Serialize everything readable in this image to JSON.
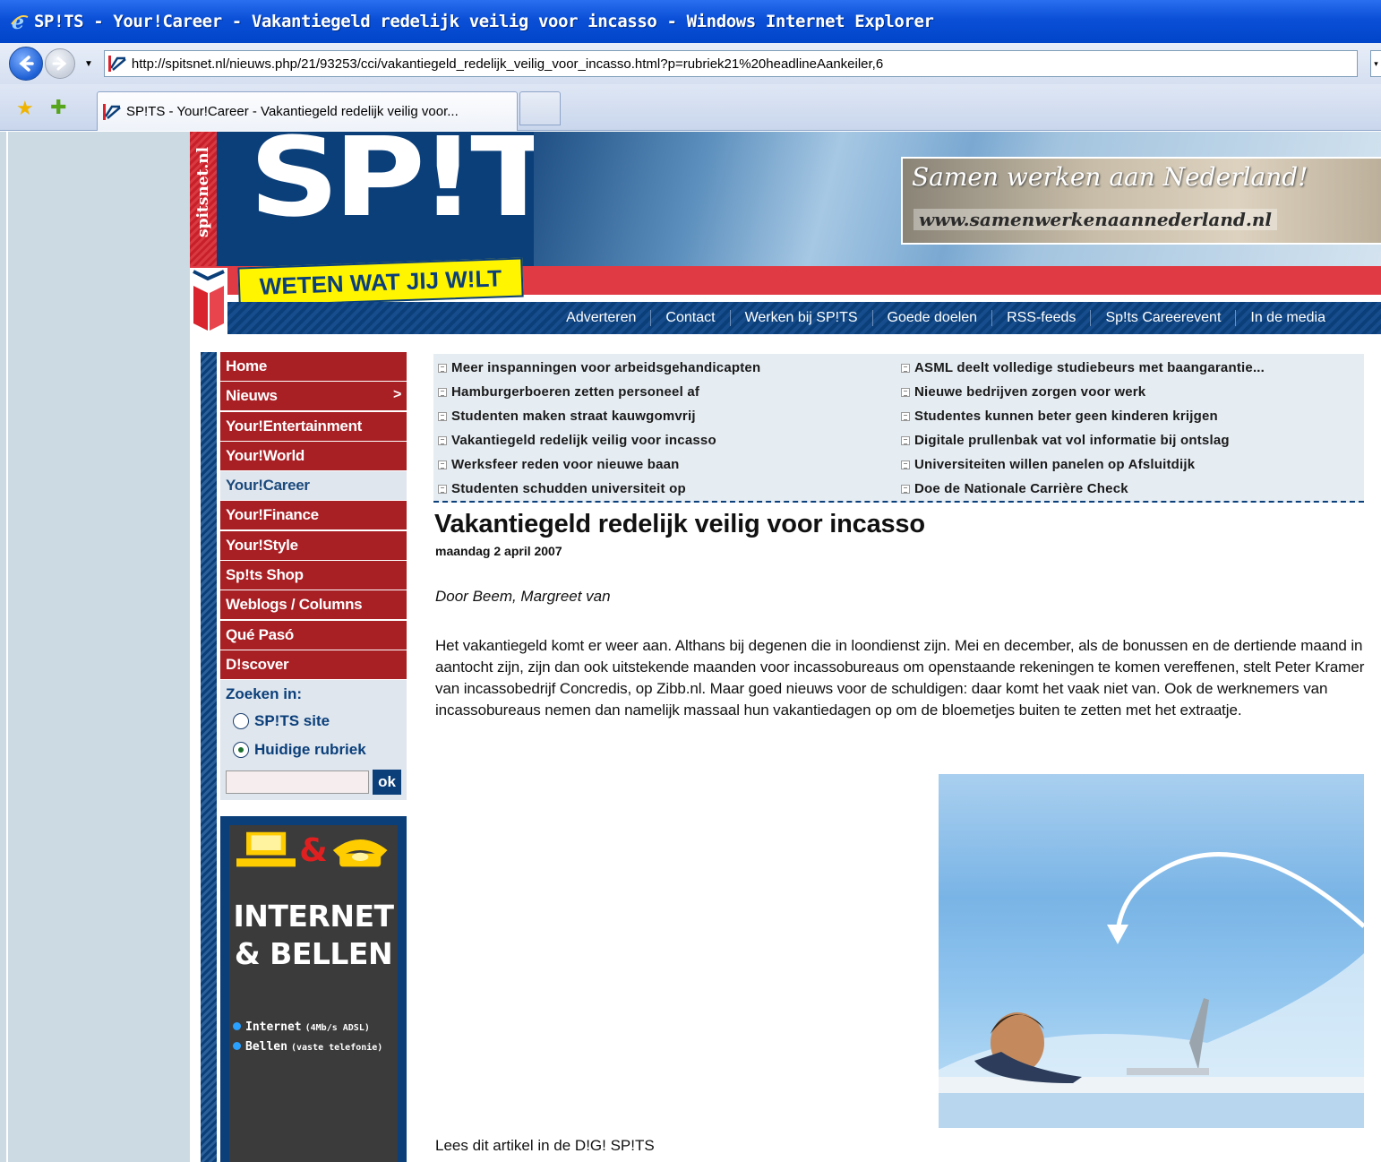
{
  "browser": {
    "window_title": "SP!TS - Your!Career - Vakantiegeld redelijk veilig voor incasso - Windows Internet Explorer",
    "url": "http://spitsnet.nl/nieuws.php/21/93253/cci/vakantiegeld_redelijk_veilig_voor_incasso.html?p=rubriek21%20headlineAankeiler,6",
    "tab_label": "SP!TS - Your!Career - Vakantiegeld redelijk veilig voor..."
  },
  "header": {
    "vertical_text": "spitsnet.nl",
    "logo": "SP!TS",
    "slogan": "WETEN WAT JIJ W!LT",
    "ad_line1": "Samen werken aan Nederland!",
    "ad_line2": "www.samenwerkenaannederland.nl",
    "top_nav": [
      "Adverteren",
      "Contact",
      "Werken bij SP!TS",
      "Goede doelen",
      "RSS-feeds",
      "Sp!ts Careerevent",
      "In de media"
    ]
  },
  "sidebar": {
    "items": [
      {
        "label": "Home"
      },
      {
        "label": "Nieuws",
        "arrow": ">"
      },
      {
        "label": "Your!Entertainment"
      },
      {
        "label": "Your!World"
      },
      {
        "label": "Your!Career"
      },
      {
        "label": "Your!Finance"
      },
      {
        "label": "Your!Style"
      },
      {
        "label": "Sp!ts Shop"
      },
      {
        "label": "Weblogs / Columns"
      },
      {
        "label": "Qué Pasó"
      },
      {
        "label": "D!scover"
      }
    ],
    "search_title": "Zoeken in:",
    "option_site": "SP!TS site",
    "option_rubriek": "Huidige rubriek",
    "ok_label": "ok"
  },
  "side_ad": {
    "amp": "&",
    "title1": "INTERNET",
    "title2": "& BELLEN",
    "bullet1": "Internet",
    "bullet1_small": "(4Mb/s ADSL)",
    "bullet2": "Bellen",
    "bullet2_small": "(vaste telefonie)"
  },
  "headlines": {
    "left": [
      "Meer inspanningen voor arbeidsgehandicapten",
      "Hamburgerboeren zetten personeel af",
      "Studenten maken straat kauwgomvrij",
      "Vakantiegeld redelijk veilig voor incasso",
      "Werksfeer reden voor nieuwe baan",
      "Studenten schudden universiteit op"
    ],
    "right": [
      "ASML deelt volledige studiebeurs met baangarantie...",
      "Nieuwe bedrijven zorgen voor werk",
      "Studentes kunnen beter geen kinderen krijgen",
      "Digitale prullenbak vat vol informatie bij ontslag",
      "Universiteiten willen panelen op Afsluitdijk",
      "Doe de Nationale Carrière Check"
    ]
  },
  "article": {
    "title": "Vakantiegeld redelijk veilig voor incasso",
    "date": "maandag 2 april 2007",
    "author": "Door Beem, Margreet van",
    "body": "Het vakantiegeld komt er weer aan. Althans bij degenen die in loondienst zijn. Mei en december, als de bonussen en de dertiende maand in aantocht zijn, zijn dan ook uitstekende maanden voor incassobureaus om openstaande rekeningen te komen vereffenen, stelt Peter Kramer van incassobedrijf Concredis, op Zibb.nl. Maar goed nieuws voor de schuldigen: daar komt het vaak niet van. Ook de werknemers van incassobureaus nemen dan namelijk massaal hun vakantiedagen op om de bloemetjes buiten te zetten met het extraatje.",
    "link": "Lees dit artikel in de D!G! SP!TS"
  }
}
